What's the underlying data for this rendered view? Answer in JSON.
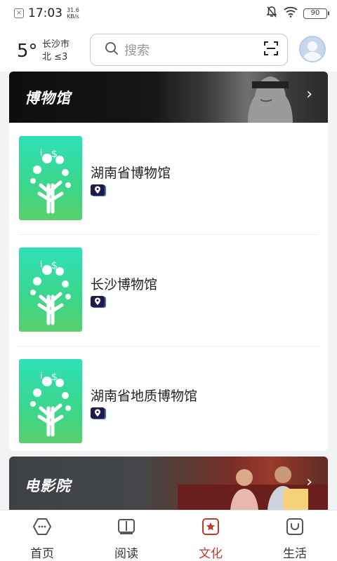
{
  "status_bar": {
    "time": "17:03",
    "net_speed_value": "31.6",
    "net_speed_unit": "KB/s",
    "battery": "90"
  },
  "header": {
    "temperature": "5°",
    "city": "长沙市",
    "wind": "北 ≤3",
    "search_placeholder": "搜索"
  },
  "sections": [
    {
      "title": "博物馆",
      "items": [
        {
          "name": "湖南省博物馆"
        },
        {
          "name": "长沙博物馆"
        },
        {
          "name": "湖南省地质博物馆"
        }
      ]
    },
    {
      "title": "电影院"
    }
  ],
  "tabbar": {
    "tabs": [
      {
        "label": "首页",
        "icon": "hexagon-home-icon"
      },
      {
        "label": "阅读",
        "icon": "open-book-icon"
      },
      {
        "label": "文化",
        "icon": "star-frame-icon"
      },
      {
        "label": "生活",
        "icon": "smile-bag-icon"
      }
    ],
    "active_index": 2,
    "active_color": "#c0392b",
    "inactive_color": "#555555"
  },
  "colors": {
    "thumb_gradient_top": "#2ee0b8",
    "thumb_gradient_bottom": "#5ad06e",
    "location_badge": "#201a48"
  }
}
